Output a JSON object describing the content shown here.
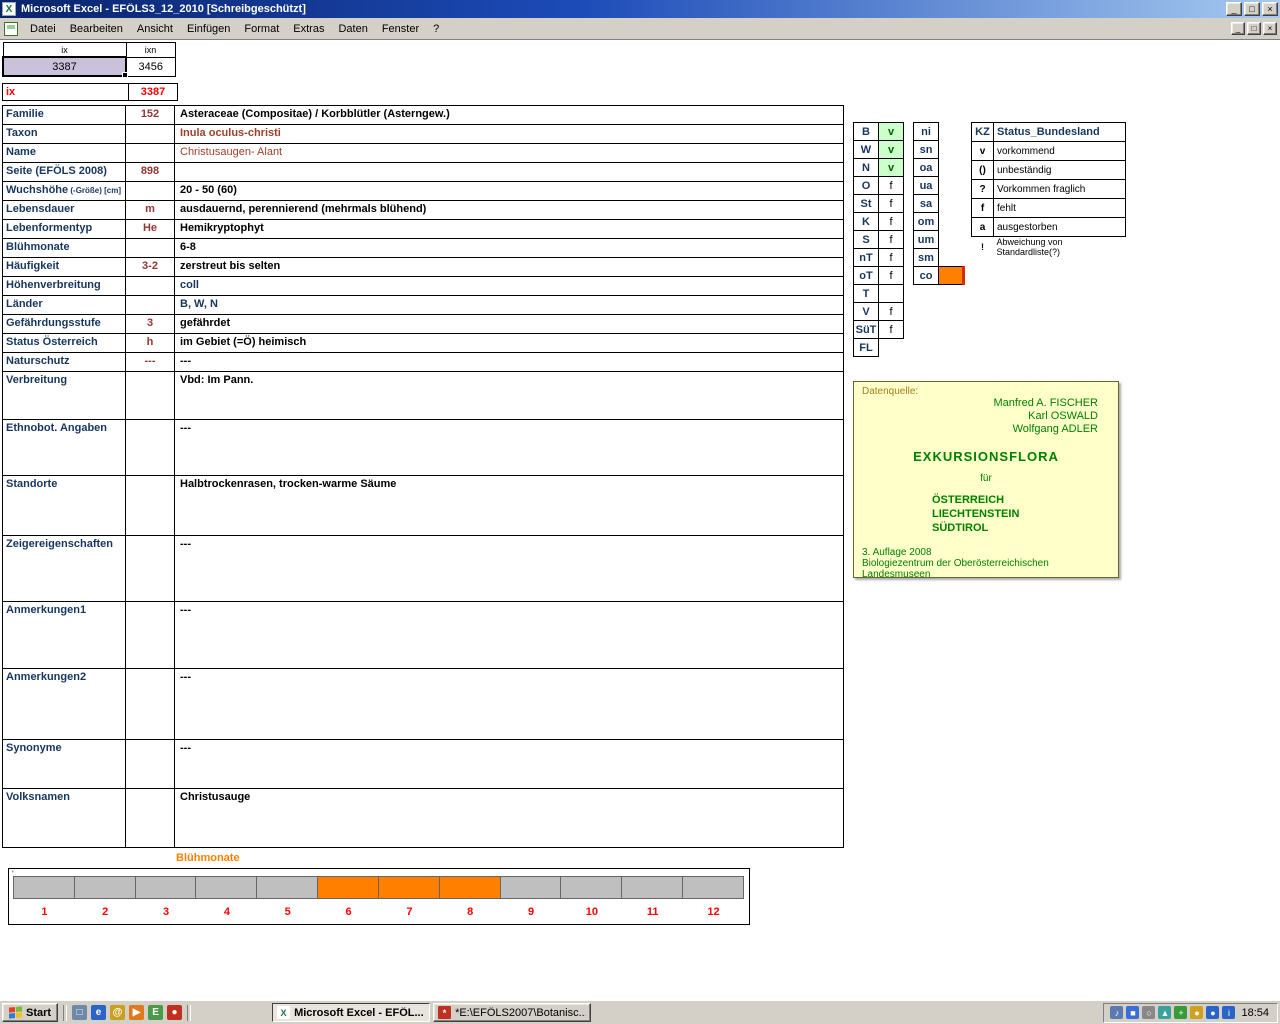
{
  "window": {
    "title": "Microsoft Excel - EFÖLS3_12_2010  [Schreibgeschützt]"
  },
  "menu_bar": {
    "items": [
      "Datei",
      "Bearbeiten",
      "Ansicht",
      "Einfügen",
      "Format",
      "Extras",
      "Daten",
      "Fenster",
      "?"
    ]
  },
  "top_cells": {
    "col1_header": "ix",
    "col2_header": "ixn",
    "col1_value": "3387",
    "col2_value": "3456",
    "ix_row_label": "ix",
    "ix_row_value": "3387"
  },
  "form": {
    "rows": [
      {
        "label": "Familie",
        "code": "152",
        "value": "Asteraceae (Compositae)  /  Korbblütler (Asterngew.)"
      },
      {
        "label": "Taxon",
        "code": "",
        "value": "Inula oculus-christi",
        "value_color": "#a0402a"
      },
      {
        "label": "Name",
        "code": "",
        "value": "Christusaugen- Alant",
        "value_color": "#a0402a",
        "value_bold": false
      },
      {
        "label": "Seite (EFÖLS 2008)",
        "code": "898",
        "value": ""
      },
      {
        "label": "Wuchshöhe",
        "label_suffix": "(-Größe) [cm]",
        "code": "",
        "value": "20 - 50 (60)"
      },
      {
        "label": "Lebensdauer",
        "code": "m",
        "value": "ausdauernd, perennierend (mehrmals blühend)"
      },
      {
        "label": "Lebenformentyp",
        "code": "He",
        "value": "Hemikryptophyt"
      },
      {
        "label": "Blühmonate",
        "code": "",
        "value": "6-8"
      },
      {
        "label": "Häufigkeit",
        "code": "3-2",
        "value": "zerstreut bis selten"
      },
      {
        "label": "Höhenverbreitung",
        "code": "",
        "value": "coll",
        "value_color": "#17365d"
      },
      {
        "label": "Länder",
        "code": "",
        "value": "B, W, N",
        "value_color": "#17365d"
      },
      {
        "label": "Gefährdungsstufe",
        "code": "3",
        "value": "gefährdet"
      },
      {
        "label": "Status Österreich",
        "code": "h",
        "value": "im Gebiet (=Ö) heimisch"
      },
      {
        "label": "Naturschutz",
        "code": "---",
        "value": "---"
      },
      {
        "label": "Verbreitung",
        "code": "",
        "value": "Vbd:  Im Pann."
      },
      {
        "label": "Ethnobot. Angaben",
        "code": "",
        "value": "---"
      },
      {
        "label": "Standorte",
        "code": "",
        "value": "Halbtrockenrasen, trocken-warme Säume"
      },
      {
        "label": "Zeigereigenschaften",
        "code": "",
        "value": "---"
      },
      {
        "label": "Anmerkungen1",
        "code": "",
        "value": "---"
      },
      {
        "label": "Anmerkungen2",
        "code": "",
        "value": "---"
      },
      {
        "label": "Synonyme",
        "code": "",
        "value": "---"
      },
      {
        "label": "Volksnamen",
        "code": "",
        "value": "Christusauge"
      }
    ]
  },
  "bundesland_table": {
    "rows": [
      {
        "code": "B",
        "status": "v"
      },
      {
        "code": "W",
        "status": "v"
      },
      {
        "code": "N",
        "status": "v"
      },
      {
        "code": "O",
        "status": "f"
      },
      {
        "code": "St",
        "status": "f"
      },
      {
        "code": "K",
        "status": "f"
      },
      {
        "code": "S",
        "status": "f"
      },
      {
        "code": "nT",
        "status": "f"
      },
      {
        "code": "oT",
        "status": "f"
      },
      {
        "code": "T",
        "status": ""
      },
      {
        "code": "V",
        "status": "f"
      },
      {
        "code": "SüT",
        "status": "f"
      },
      {
        "code": "FL",
        "status": null
      }
    ]
  },
  "region_table": {
    "rows": [
      {
        "code": "ni"
      },
      {
        "code": "sn"
      },
      {
        "code": "oa"
      },
      {
        "code": "ua"
      },
      {
        "code": "sa"
      },
      {
        "code": "om"
      },
      {
        "code": "um"
      },
      {
        "code": "sm"
      },
      {
        "code": "co",
        "highlight": true
      }
    ]
  },
  "legend": {
    "header_code": "KZ",
    "header_label": "Status_Bundesland",
    "rows": [
      {
        "code": "v",
        "label": "vorkommend"
      },
      {
        "code": "()",
        "label": "unbeständig"
      },
      {
        "code": "?",
        "label": "Vorkommen fraglich"
      },
      {
        "code": "f",
        "label": "fehlt"
      },
      {
        "code": "a",
        "label": "ausgestorben"
      },
      {
        "code": "!",
        "label": "Abweichung von Standardliste(?)",
        "borderless": true
      }
    ]
  },
  "source_box": {
    "title": "Datenquelle:",
    "authors": [
      "Manfred A. FISCHER",
      "Karl OSWALD",
      "Wolfgang ADLER"
    ],
    "work_title": "EXKURSIONSFLORA",
    "fuer": "für",
    "regions": [
      "ÖSTERREICH",
      "LIECHTENSTEIN",
      "SÜDTIROL"
    ],
    "edition": "3. Auflage 2008",
    "publisher": "Biologiezentrum der Oberösterreichischen Landesmuseen"
  },
  "chart_data": {
    "type": "bar",
    "title": "Blühmonate",
    "categories": [
      "1",
      "2",
      "3",
      "4",
      "5",
      "6",
      "7",
      "8",
      "9",
      "10",
      "11",
      "12"
    ],
    "values": [
      0,
      0,
      0,
      0,
      0,
      1,
      1,
      1,
      0,
      0,
      0,
      0
    ],
    "active_months": [
      6,
      7,
      8
    ],
    "active_color": "#ff8000",
    "inactive_color": "#bfbfbf",
    "xlabel": "",
    "ylabel": ""
  },
  "colors": {
    "accent_orange": "#ff8000",
    "status_present_bg": "#ccffcc",
    "status_present_text": "#006100",
    "label_navy": "#17365d",
    "taxon_red": "#a0402a",
    "code_brown": "#943634",
    "highlight_red": "#ff0000",
    "flora_green": "#008000",
    "source_box_bg": "#ffffc9",
    "selected_cell_bg": "#ccc1da"
  },
  "taskbar": {
    "start_label": "Start",
    "quick_launch": [
      {
        "name": "show-desktop-icon",
        "glyph": "□",
        "color": "#6f87a8"
      },
      {
        "name": "internet-explorer-icon",
        "glyph": "e",
        "color": "#2a64c8"
      },
      {
        "name": "email-icon",
        "glyph": "@",
        "color": "#c8a020"
      },
      {
        "name": "media-player-icon",
        "glyph": "▶",
        "color": "#e07820"
      },
      {
        "name": "explorer-icon",
        "glyph": "E",
        "color": "#4a9a4a"
      },
      {
        "name": "realplayer-icon",
        "glyph": "●",
        "color": "#c03020"
      }
    ],
    "tasks": [
      {
        "label": "Microsoft Excel - EFÖL...",
        "active": true,
        "icon_name": "excel-task-icon",
        "icon_glyph": "X",
        "icon_color": "#ffffff",
        "icon_text_color": "#1e7145"
      },
      {
        "label": "*E:\\EFÖLS2007\\Botanisc...",
        "active": false,
        "icon_name": "botanik-app-icon",
        "icon_glyph": "*",
        "icon_color": "#c03020",
        "icon_text_color": "#ffffff"
      }
    ],
    "tray_icons": [
      {
        "name": "volume-icon",
        "glyph": "♪",
        "color": "#5a7ab0"
      },
      {
        "name": "display-settings-icon",
        "glyph": "■",
        "color": "#3a6fd8"
      },
      {
        "name": "magnifier-icon",
        "glyph": "○",
        "color": "#888888"
      },
      {
        "name": "network-icon",
        "glyph": "▲",
        "color": "#3aa0a0"
      },
      {
        "name": "antivirus-icon",
        "glyph": "+",
        "color": "#3a9a3a"
      },
      {
        "name": "update-icon",
        "glyph": "●",
        "color": "#d0a020"
      },
      {
        "name": "messenger-icon",
        "glyph": "●",
        "color": "#2a64c8"
      },
      {
        "name": "info-icon",
        "glyph": "i",
        "color": "#2a64c8"
      }
    ],
    "clock": "18:54"
  }
}
